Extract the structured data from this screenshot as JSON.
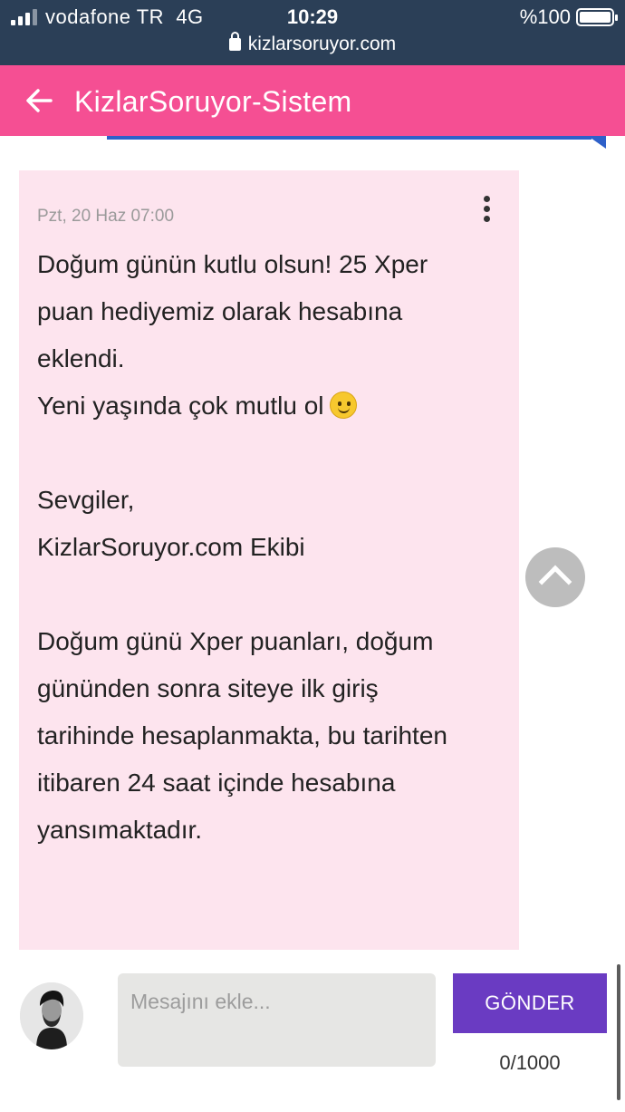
{
  "status_bar": {
    "carrier": "vodafone TR",
    "network": "4G",
    "time": "10:29",
    "battery": "%100",
    "url": "kizlarsoruyor.com"
  },
  "app_bar": {
    "title": "KizlarSoruyor-Sistem",
    "background_color": "#f54f93"
  },
  "message": {
    "date": "Pzt, 20 Haz 07:00",
    "lines": [
      "Doğum günün kutlu olsun! 25 Xper",
      "puan hediyemiz olarak hesabına",
      "eklendi.",
      "Yeni yaşında çok mutlu ol",
      "Sevgiler,",
      "KizlarSoruyor.com Ekibi",
      "Doğum günü Xper puanları, doğum",
      "gününden sonra siteye ilk giriş",
      "tarihinde hesaplanmakta, bu tarihten",
      "itibaren 24 saat içinde hesabına",
      "yansımaktadır."
    ],
    "background_color": "#fde4ee"
  },
  "compose": {
    "placeholder": "Mesajını ekle...",
    "value": "",
    "send_label": "GÖNDER",
    "counter": "0/1000",
    "send_color": "#6a3bc2"
  },
  "icons": {
    "back": "arrow-left-icon",
    "more": "more-vertical-icon",
    "scroll_top": "chevron-up-icon",
    "lock": "lock-icon",
    "smiley": "smiley-icon"
  }
}
